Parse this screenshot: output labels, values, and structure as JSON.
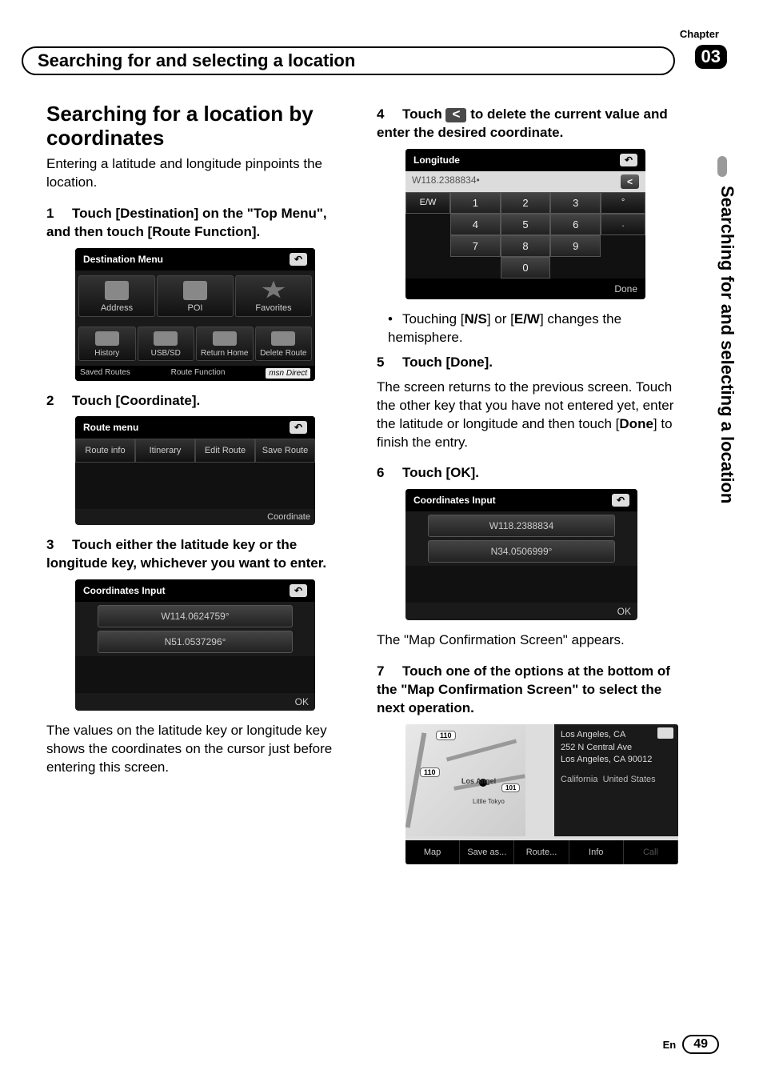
{
  "chapter_label": "Chapter",
  "chapter_num": "03",
  "header_title": "Searching for and selecting a location",
  "side_title": "Searching for and selecting a location",
  "left": {
    "section_title": "Searching for a location by coordinates",
    "intro": "Entering a latitude and longitude pinpoints the location.",
    "step1": "Touch [Destination] on the \"Top Menu\", and then touch [Route Function].",
    "dest_menu_title": "Destination Menu",
    "dest_items": [
      "Address",
      "POI",
      "Favorites",
      "History",
      "USB/SD",
      "Return Home",
      "Delete Route"
    ],
    "dest_bottom": [
      "Saved Routes",
      "Route Function"
    ],
    "msn": "msn Direct",
    "step2": "Touch [Coordinate].",
    "route_menu_title": "Route menu",
    "route_items": [
      "Route info",
      "Itinerary",
      "Edit Route",
      "Save Route"
    ],
    "coordinate_btn": "Coordinate",
    "step3": "Touch either the latitude key or the longitude key, whichever you want to enter.",
    "coord_input_title": "Coordinates Input",
    "coord1_lon": "W114.0624759°",
    "coord1_lat": "N51.0537296°",
    "ok": "OK",
    "para_bottom": "The values on the latitude key or longitude key shows the coordinates on the cursor just before entering this screen."
  },
  "right": {
    "step4_a": "Touch",
    "step4_b": "to delete the current value and enter the desired coordinate.",
    "delete_glyph": "<",
    "lon_title": "Longitude",
    "lon_display": "W118.2388834•",
    "ew": "E/W",
    "keys": [
      "1",
      "2",
      "3",
      "°",
      "4",
      "5",
      "6",
      ".",
      "7",
      "8",
      "9",
      "",
      "",
      "0",
      "",
      ""
    ],
    "done": "Done",
    "bullet": "Touching [N/S] or [E/W] changes the hemisphere.",
    "step5": "Touch [Done].",
    "step5_body": "The screen returns to the previous screen. Touch the other key that you have not entered yet, enter the latitude or longitude and then touch [Done] to finish the entry.",
    "step6": "Touch [OK].",
    "coord2_lon": "W118.2388834",
    "coord2_lat": "N34.0506999°",
    "ok": "OK",
    "map_para": "The \"Map Confirmation Screen\" appears.",
    "step7": "Touch one of the options at the bottom of the \"Map Confirmation Screen\" to select the next operation.",
    "map": {
      "addr1": "Los Angeles, CA",
      "addr2": "252 N Central Ave",
      "addr3": "Los Angeles, CA 90012",
      "state": "California",
      "country": "United States",
      "label1": "Los Angel",
      "label2": "Little Tokyo",
      "route110a": "110",
      "route110b": "110",
      "route101": "101",
      "buttons": [
        "Map",
        "Save as...",
        "Route...",
        "Info",
        "Call"
      ]
    }
  },
  "footer_lang": "En",
  "footer_page": "49"
}
